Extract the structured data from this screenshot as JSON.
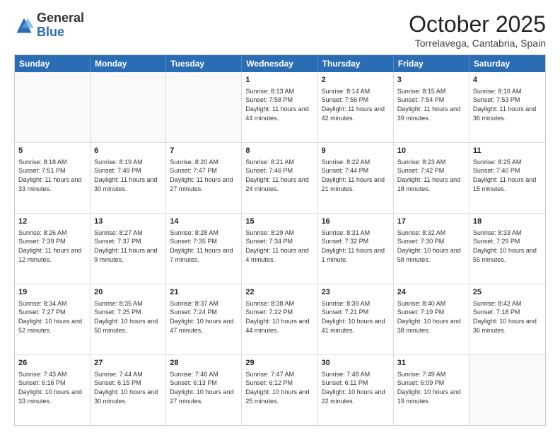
{
  "header": {
    "logo_general": "General",
    "logo_blue": "Blue",
    "month_title": "October 2025",
    "location": "Torrelavega, Cantabria, Spain"
  },
  "weekdays": [
    "Sunday",
    "Monday",
    "Tuesday",
    "Wednesday",
    "Thursday",
    "Friday",
    "Saturday"
  ],
  "weeks": [
    [
      {
        "day": "",
        "info": ""
      },
      {
        "day": "",
        "info": ""
      },
      {
        "day": "",
        "info": ""
      },
      {
        "day": "1",
        "info": "Sunrise: 8:13 AM\nSunset: 7:58 PM\nDaylight: 11 hours and 44 minutes."
      },
      {
        "day": "2",
        "info": "Sunrise: 8:14 AM\nSunset: 7:56 PM\nDaylight: 11 hours and 42 minutes."
      },
      {
        "day": "3",
        "info": "Sunrise: 8:15 AM\nSunset: 7:54 PM\nDaylight: 11 hours and 39 minutes."
      },
      {
        "day": "4",
        "info": "Sunrise: 8:16 AM\nSunset: 7:53 PM\nDaylight: 11 hours and 36 minutes."
      }
    ],
    [
      {
        "day": "5",
        "info": "Sunrise: 8:18 AM\nSunset: 7:51 PM\nDaylight: 11 hours and 33 minutes."
      },
      {
        "day": "6",
        "info": "Sunrise: 8:19 AM\nSunset: 7:49 PM\nDaylight: 11 hours and 30 minutes."
      },
      {
        "day": "7",
        "info": "Sunrise: 8:20 AM\nSunset: 7:47 PM\nDaylight: 11 hours and 27 minutes."
      },
      {
        "day": "8",
        "info": "Sunrise: 8:21 AM\nSunset: 7:46 PM\nDaylight: 11 hours and 24 minutes."
      },
      {
        "day": "9",
        "info": "Sunrise: 8:22 AM\nSunset: 7:44 PM\nDaylight: 11 hours and 21 minutes."
      },
      {
        "day": "10",
        "info": "Sunrise: 8:23 AM\nSunset: 7:42 PM\nDaylight: 11 hours and 18 minutes."
      },
      {
        "day": "11",
        "info": "Sunrise: 8:25 AM\nSunset: 7:40 PM\nDaylight: 11 hours and 15 minutes."
      }
    ],
    [
      {
        "day": "12",
        "info": "Sunrise: 8:26 AM\nSunset: 7:39 PM\nDaylight: 11 hours and 12 minutes."
      },
      {
        "day": "13",
        "info": "Sunrise: 8:27 AM\nSunset: 7:37 PM\nDaylight: 11 hours and 9 minutes."
      },
      {
        "day": "14",
        "info": "Sunrise: 8:28 AM\nSunset: 7:35 PM\nDaylight: 11 hours and 7 minutes."
      },
      {
        "day": "15",
        "info": "Sunrise: 8:29 AM\nSunset: 7:34 PM\nDaylight: 11 hours and 4 minutes."
      },
      {
        "day": "16",
        "info": "Sunrise: 8:31 AM\nSunset: 7:32 PM\nDaylight: 11 hours and 1 minute."
      },
      {
        "day": "17",
        "info": "Sunrise: 8:32 AM\nSunset: 7:30 PM\nDaylight: 10 hours and 58 minutes."
      },
      {
        "day": "18",
        "info": "Sunrise: 8:33 AM\nSunset: 7:29 PM\nDaylight: 10 hours and 55 minutes."
      }
    ],
    [
      {
        "day": "19",
        "info": "Sunrise: 8:34 AM\nSunset: 7:27 PM\nDaylight: 10 hours and 52 minutes."
      },
      {
        "day": "20",
        "info": "Sunrise: 8:35 AM\nSunset: 7:25 PM\nDaylight: 10 hours and 50 minutes."
      },
      {
        "day": "21",
        "info": "Sunrise: 8:37 AM\nSunset: 7:24 PM\nDaylight: 10 hours and 47 minutes."
      },
      {
        "day": "22",
        "info": "Sunrise: 8:38 AM\nSunset: 7:22 PM\nDaylight: 10 hours and 44 minutes."
      },
      {
        "day": "23",
        "info": "Sunrise: 8:39 AM\nSunset: 7:21 PM\nDaylight: 10 hours and 41 minutes."
      },
      {
        "day": "24",
        "info": "Sunrise: 8:40 AM\nSunset: 7:19 PM\nDaylight: 10 hours and 38 minutes."
      },
      {
        "day": "25",
        "info": "Sunrise: 8:42 AM\nSunset: 7:18 PM\nDaylight: 10 hours and 36 minutes."
      }
    ],
    [
      {
        "day": "26",
        "info": "Sunrise: 7:43 AM\nSunset: 6:16 PM\nDaylight: 10 hours and 33 minutes."
      },
      {
        "day": "27",
        "info": "Sunrise: 7:44 AM\nSunset: 6:15 PM\nDaylight: 10 hours and 30 minutes."
      },
      {
        "day": "28",
        "info": "Sunrise: 7:46 AM\nSunset: 6:13 PM\nDaylight: 10 hours and 27 minutes."
      },
      {
        "day": "29",
        "info": "Sunrise: 7:47 AM\nSunset: 6:12 PM\nDaylight: 10 hours and 25 minutes."
      },
      {
        "day": "30",
        "info": "Sunrise: 7:48 AM\nSunset: 6:11 PM\nDaylight: 10 hours and 22 minutes."
      },
      {
        "day": "31",
        "info": "Sunrise: 7:49 AM\nSunset: 6:09 PM\nDaylight: 10 hours and 19 minutes."
      },
      {
        "day": "",
        "info": ""
      }
    ]
  ]
}
